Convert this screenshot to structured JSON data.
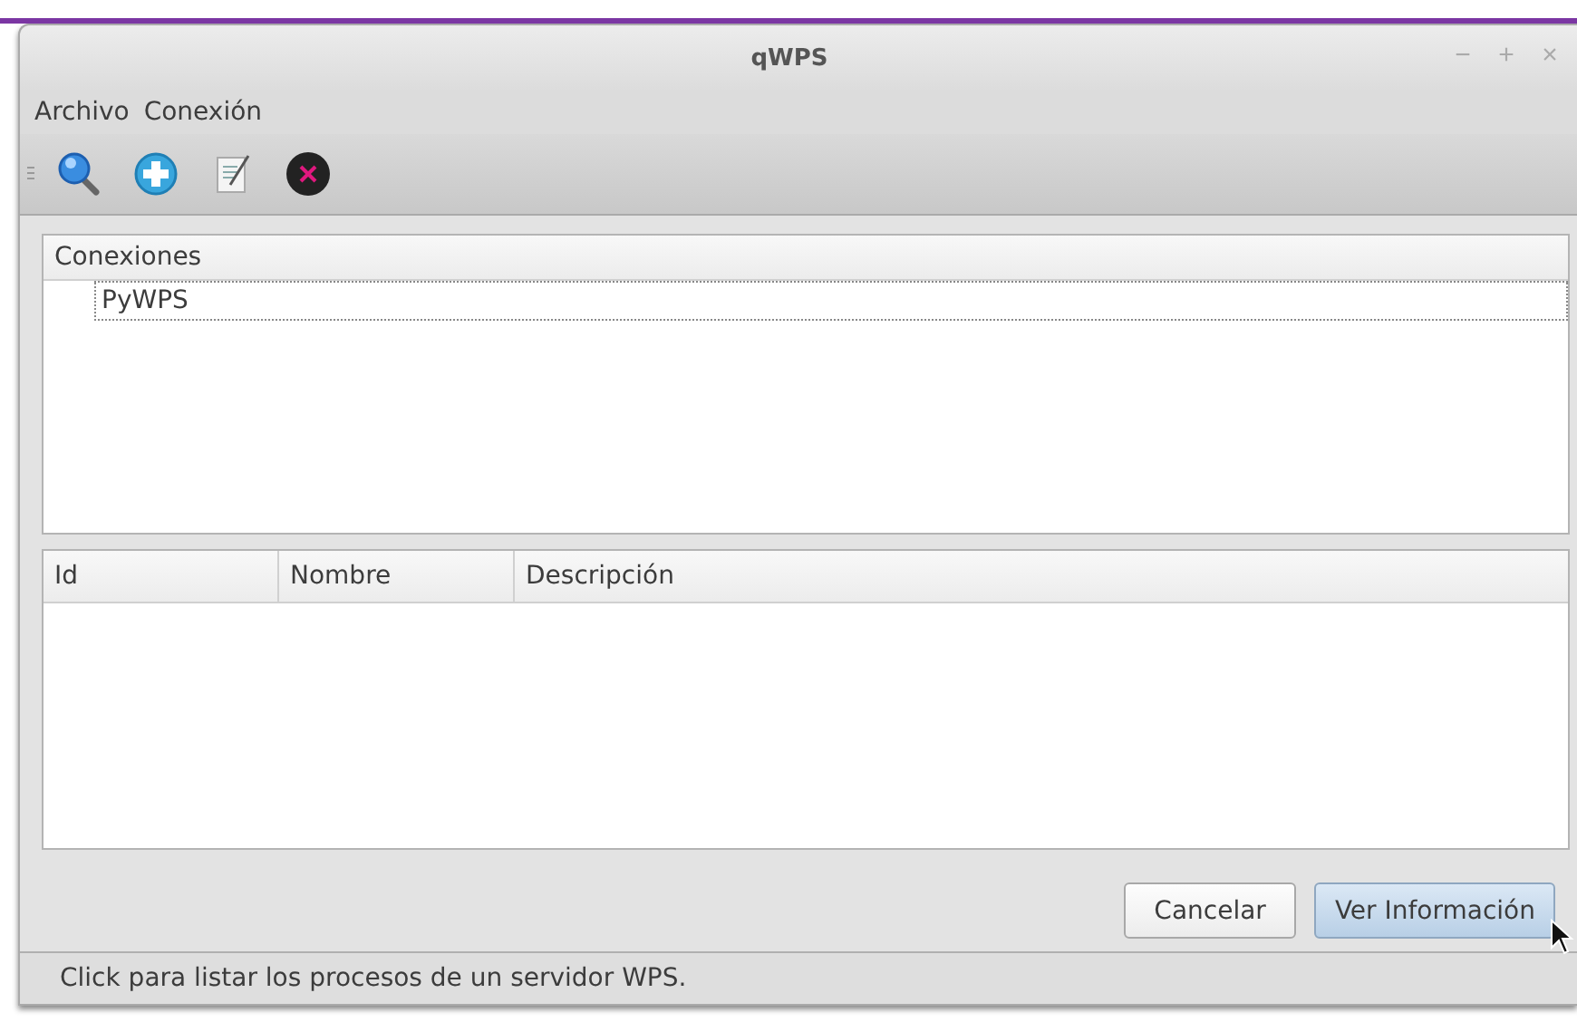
{
  "window": {
    "title": "qWPS",
    "controls": [
      "−",
      "+",
      "×"
    ]
  },
  "menu": [
    "Archivo",
    "Conexión"
  ],
  "toolbar": [
    {
      "kind": "search"
    },
    {
      "kind": "add"
    },
    {
      "kind": "edit"
    },
    {
      "kind": "delete"
    }
  ],
  "tree": {
    "header": "Conexiones",
    "items": [
      {
        "label": "PyWPS",
        "selected": true
      }
    ]
  },
  "table": {
    "columns": [
      "Id",
      "Nombre",
      "Descripción"
    ]
  },
  "buttons": [
    {
      "label": "Cancelar",
      "highlighted": false
    },
    {
      "label": "Ver Información",
      "highlighted": true
    }
  ],
  "status_bar": "Click para listar los procesos de un servidor WPS."
}
